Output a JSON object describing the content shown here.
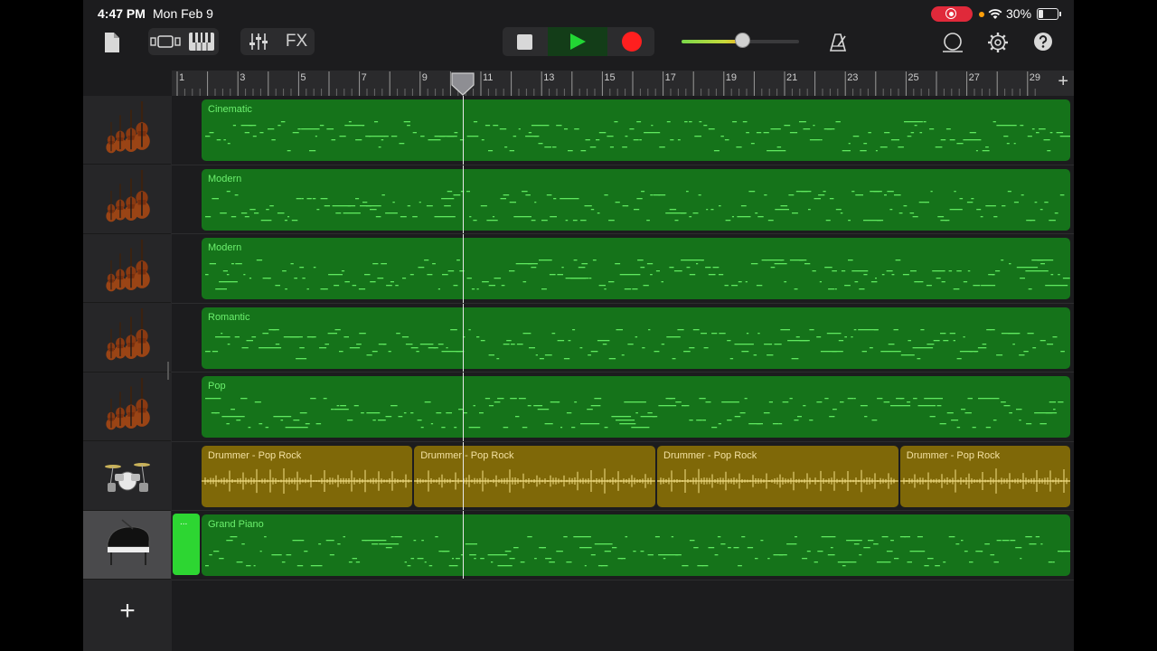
{
  "status": {
    "time": "4:47 PM",
    "date": "Mon Feb 9",
    "battery_pct": "30%",
    "battery_level": 0.3
  },
  "toolbar": {
    "fx_label": "FX",
    "volume_level": 0.52
  },
  "ruler": {
    "bar_numbers": [
      "1",
      "3",
      "5",
      "7",
      "9",
      "11",
      "13",
      "15",
      "17",
      "19",
      "21",
      "23",
      "25",
      "27",
      "29"
    ],
    "playhead_bar": 10.4
  },
  "tracks": [
    {
      "instrument": "violin-icon",
      "regions": [
        {
          "name": "Cinematic",
          "start": 1,
          "end": 30.8,
          "color": "green"
        }
      ]
    },
    {
      "instrument": "violin-icon",
      "regions": [
        {
          "name": "Modern",
          "start": 1,
          "end": 30.3,
          "color": "green"
        }
      ]
    },
    {
      "instrument": "violin-icon",
      "regions": [
        {
          "name": "Modern",
          "start": 1,
          "end": 30.3,
          "color": "green"
        }
      ]
    },
    {
      "instrument": "violin-icon",
      "regions": [
        {
          "name": "Romantic",
          "start": 1,
          "end": 30.8,
          "color": "green"
        }
      ]
    },
    {
      "instrument": "violin-icon",
      "regions": [
        {
          "name": "Pop",
          "start": 1,
          "end": 30.8,
          "color": "green"
        }
      ]
    },
    {
      "instrument": "drum-kit-icon",
      "regions": [
        {
          "name": "Drummer - Pop Rock",
          "start": 1,
          "end": 8,
          "color": "yellow"
        },
        {
          "name": "Drummer - Pop Rock",
          "start": 8,
          "end": 16,
          "color": "yellow"
        },
        {
          "name": "Drummer - Pop Rock",
          "start": 16,
          "end": 24,
          "color": "yellow"
        },
        {
          "name": "Drummer - Pop Rock",
          "start": 24,
          "end": 30.3,
          "color": "yellow"
        }
      ]
    },
    {
      "instrument": "grand-piano-icon",
      "selected": true,
      "regions": [
        {
          "name": "Grand Piano",
          "start": 1,
          "end": 30.8,
          "color": "green"
        }
      ]
    }
  ],
  "mini_region_label": "...",
  "add_track_label": "+",
  "add_section_label": "+",
  "colors": {
    "region_green": "#15731a",
    "region_green_text": "#6cf06e",
    "region_yellow": "#7f6808",
    "play_green": "#22d634",
    "record_red": "#ff1f1f"
  }
}
